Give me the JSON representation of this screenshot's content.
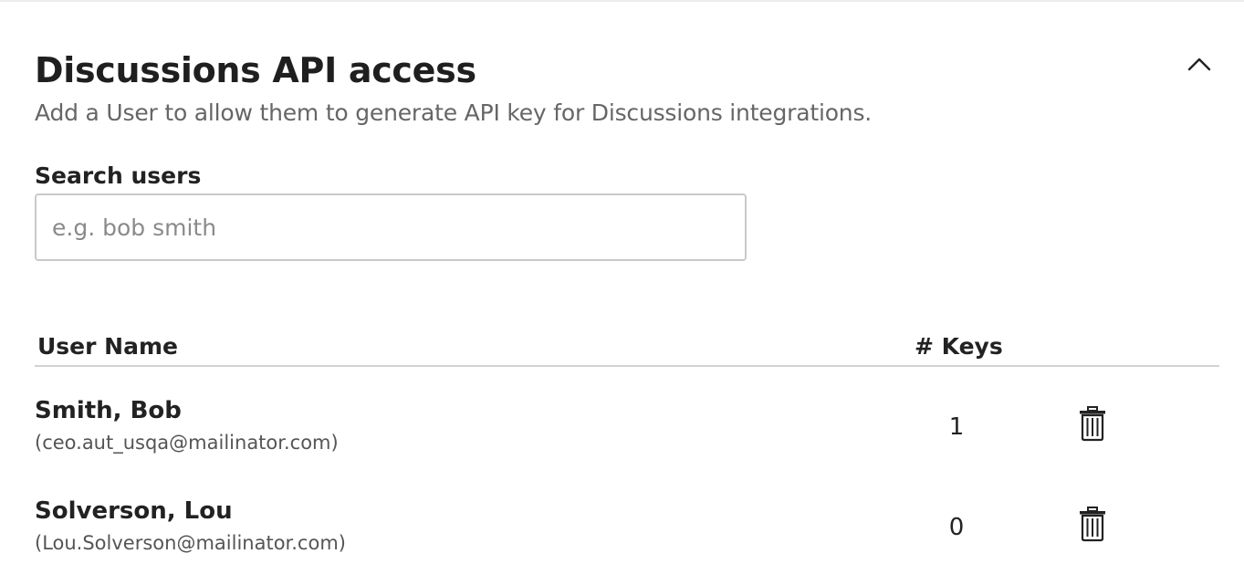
{
  "section": {
    "title": "Discussions API access",
    "subtitle": "Add a User to allow them to generate API key for Discussions integrations.",
    "collapse_icon": "chevron-up-icon"
  },
  "search": {
    "label": "Search users",
    "placeholder": "e.g. bob smith",
    "value": ""
  },
  "table": {
    "columns": [
      "User Name",
      "# Keys"
    ],
    "rows": [
      {
        "name": "Smith, Bob",
        "email": "(ceo.aut_usqa@mailinator.com)",
        "keys": "1",
        "action_icon": "trash-icon"
      },
      {
        "name": "Solverson, Lou",
        "email": "(Lou.Solverson@mailinator.com)",
        "keys": "0",
        "action_icon": "trash-icon"
      }
    ]
  },
  "colors": {
    "text": "#222222",
    "muted": "#666666",
    "border": "#c9c9c9",
    "rule": "#d2d2d2"
  }
}
